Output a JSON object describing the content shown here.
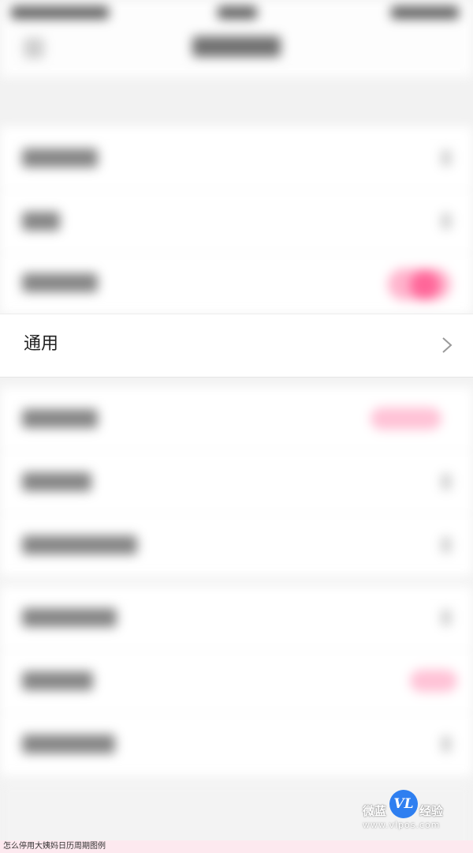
{
  "settings": {
    "focused_row_label": "通用",
    "focused_row_chevron_icon": "chevron-right-icon"
  },
  "watermark": {
    "left_text": "微蓝",
    "logo_text": "VL",
    "right_text": "经验",
    "url": "www.vlpos.com"
  },
  "caption": {
    "text": "怎么停用大姨妈日历周期图例"
  },
  "colors": {
    "accent_pink": "#ff6699",
    "logo_blue": "#2f7ff0"
  }
}
